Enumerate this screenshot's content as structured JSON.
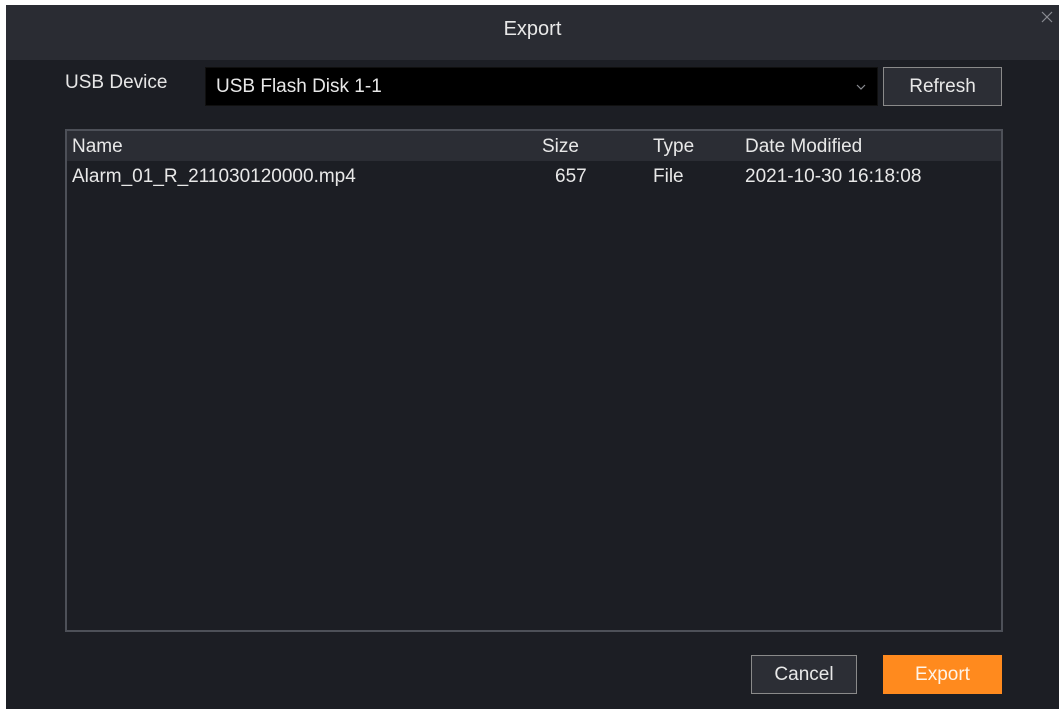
{
  "dialog": {
    "title": "Export",
    "close_icon": "close-icon"
  },
  "usb": {
    "label": "USB Device",
    "selected": "USB Flash Disk 1-1",
    "dropdown_icon": "chevron-down-icon"
  },
  "buttons": {
    "refresh": "Refresh",
    "cancel": "Cancel",
    "export": "Export"
  },
  "table": {
    "headers": [
      "Name",
      "Size",
      "Type",
      "Date Modified"
    ],
    "rows": [
      [
        "Alarm_01_R_211030120000.mp4",
        "657",
        "File",
        "2021-10-30 16:18:08"
      ]
    ]
  },
  "colors": {
    "background": "#1c1e24",
    "titlebar": "#2a2c33",
    "accent": "#ff8a1e"
  }
}
